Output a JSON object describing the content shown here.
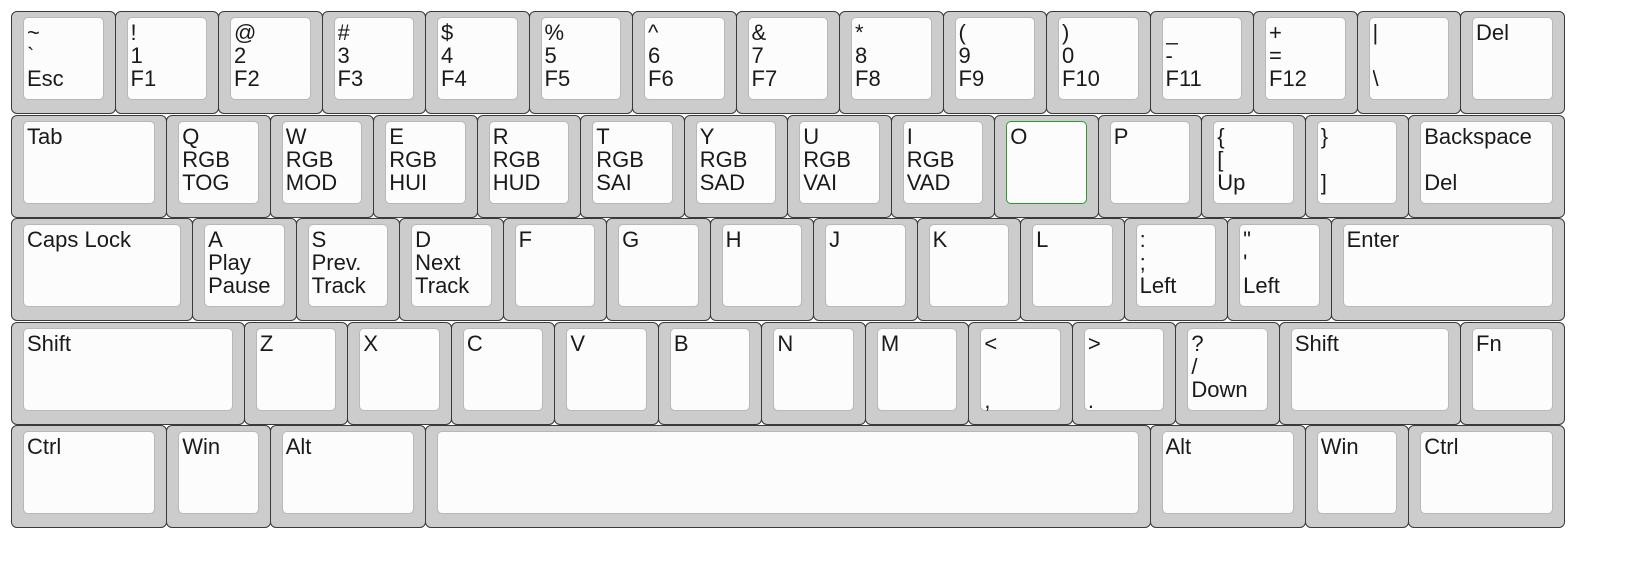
{
  "keyboard": {
    "rows": [
      {
        "keys": [
          {
            "id": "esc",
            "units": 1,
            "legends": [
              "~",
              "`",
              "Esc"
            ],
            "mode": "stack"
          },
          {
            "id": "1",
            "units": 1,
            "legends": [
              "!",
              "1",
              "F1"
            ],
            "mode": "stack"
          },
          {
            "id": "2",
            "units": 1,
            "legends": [
              "@",
              "2",
              "F2"
            ],
            "mode": "stack"
          },
          {
            "id": "3",
            "units": 1,
            "legends": [
              "#",
              "3",
              "F3"
            ],
            "mode": "stack"
          },
          {
            "id": "4",
            "units": 1,
            "legends": [
              "$",
              "4",
              "F4"
            ],
            "mode": "stack"
          },
          {
            "id": "5",
            "units": 1,
            "legends": [
              "%",
              "5",
              "F5"
            ],
            "mode": "stack"
          },
          {
            "id": "6",
            "units": 1,
            "legends": [
              "^",
              "6",
              "F6"
            ],
            "mode": "stack"
          },
          {
            "id": "7",
            "units": 1,
            "legends": [
              "&",
              "7",
              "F7"
            ],
            "mode": "stack"
          },
          {
            "id": "8",
            "units": 1,
            "legends": [
              "*",
              "8",
              "F8"
            ],
            "mode": "stack"
          },
          {
            "id": "9",
            "units": 1,
            "legends": [
              "(",
              "9",
              "F9"
            ],
            "mode": "stack"
          },
          {
            "id": "0",
            "units": 1,
            "legends": [
              ")",
              "0",
              "F10"
            ],
            "mode": "stack"
          },
          {
            "id": "minus",
            "units": 1,
            "legends": [
              "_",
              "-",
              "F11"
            ],
            "mode": "stack"
          },
          {
            "id": "equal",
            "units": 1,
            "legends": [
              "+",
              "=",
              "F12"
            ],
            "mode": "stack"
          },
          {
            "id": "backslash",
            "units": 1,
            "legends": [
              "|",
              "",
              "\\"
            ],
            "mode": "stack"
          },
          {
            "id": "del",
            "units": 1,
            "legends": [
              "Del"
            ],
            "mode": "stack"
          }
        ]
      },
      {
        "keys": [
          {
            "id": "tab",
            "units": 1.5,
            "legends": [
              "Tab"
            ],
            "mode": "stack"
          },
          {
            "id": "q",
            "units": 1,
            "legends": [
              "Q",
              "RGB",
              "TOG"
            ],
            "mode": "stack"
          },
          {
            "id": "w",
            "units": 1,
            "legends": [
              "W",
              "RGB",
              "MOD"
            ],
            "mode": "stack"
          },
          {
            "id": "e",
            "units": 1,
            "legends": [
              "E",
              "RGB",
              "HUI"
            ],
            "mode": "stack"
          },
          {
            "id": "r",
            "units": 1,
            "legends": [
              "R",
              "RGB",
              "HUD"
            ],
            "mode": "stack"
          },
          {
            "id": "t",
            "units": 1,
            "legends": [
              "T",
              "RGB",
              "SAI"
            ],
            "mode": "stack"
          },
          {
            "id": "y",
            "units": 1,
            "legends": [
              "Y",
              "RGB",
              "SAD"
            ],
            "mode": "stack"
          },
          {
            "id": "u",
            "units": 1,
            "legends": [
              "U",
              "RGB",
              "VAI"
            ],
            "mode": "stack"
          },
          {
            "id": "i",
            "units": 1,
            "legends": [
              "I",
              "RGB",
              "VAD"
            ],
            "mode": "stack"
          },
          {
            "id": "o",
            "units": 1,
            "legends": [
              "O"
            ],
            "mode": "stack",
            "selected": true
          },
          {
            "id": "p",
            "units": 1,
            "legends": [
              "P"
            ],
            "mode": "stack"
          },
          {
            "id": "lbracket",
            "units": 1,
            "legends": [
              "{",
              "[",
              "Up"
            ],
            "mode": "stack"
          },
          {
            "id": "rbracket",
            "units": 1,
            "legends": [
              "}",
              "",
              "]"
            ],
            "mode": "stack"
          },
          {
            "id": "backspace",
            "units": 1.5,
            "legends": [
              "Backspace",
              "",
              "Del"
            ],
            "mode": "stack"
          }
        ]
      },
      {
        "keys": [
          {
            "id": "caps",
            "units": 1.75,
            "legends": [
              "Caps Lock"
            ],
            "mode": "stack"
          },
          {
            "id": "a",
            "units": 1,
            "legends": [
              "A",
              "Play",
              "Pause"
            ],
            "mode": "stack"
          },
          {
            "id": "s",
            "units": 1,
            "legends": [
              "S",
              "Prev.",
              "Track"
            ],
            "mode": "stack"
          },
          {
            "id": "d",
            "units": 1,
            "legends": [
              "D",
              "Next",
              "Track"
            ],
            "mode": "stack"
          },
          {
            "id": "f",
            "units": 1,
            "legends": [
              "F"
            ],
            "mode": "stack"
          },
          {
            "id": "g",
            "units": 1,
            "legends": [
              "G"
            ],
            "mode": "stack"
          },
          {
            "id": "h",
            "units": 1,
            "legends": [
              "H"
            ],
            "mode": "stack"
          },
          {
            "id": "j",
            "units": 1,
            "legends": [
              "J"
            ],
            "mode": "stack"
          },
          {
            "id": "k",
            "units": 1,
            "legends": [
              "K"
            ],
            "mode": "stack"
          },
          {
            "id": "l",
            "units": 1,
            "legends": [
              "L"
            ],
            "mode": "stack"
          },
          {
            "id": "semicolon",
            "units": 1,
            "legends": [
              ":",
              ";",
              "Left"
            ],
            "mode": "stack"
          },
          {
            "id": "quote",
            "units": 1,
            "legends": [
              "\"",
              "'",
              "Left"
            ],
            "mode": "stack"
          },
          {
            "id": "enter",
            "units": 2.25,
            "legends": [
              "Enter"
            ],
            "mode": "stack"
          }
        ]
      },
      {
        "keys": [
          {
            "id": "lshift",
            "units": 2.25,
            "legends": [
              "Shift"
            ],
            "mode": "stack"
          },
          {
            "id": "z",
            "units": 1,
            "legends": [
              "Z"
            ],
            "mode": "stack"
          },
          {
            "id": "x",
            "units": 1,
            "legends": [
              "X"
            ],
            "mode": "stack"
          },
          {
            "id": "c",
            "units": 1,
            "legends": [
              "C"
            ],
            "mode": "stack"
          },
          {
            "id": "v",
            "units": 1,
            "legends": [
              "V"
            ],
            "mode": "stack"
          },
          {
            "id": "b",
            "units": 1,
            "legends": [
              "B"
            ],
            "mode": "stack"
          },
          {
            "id": "n",
            "units": 1,
            "legends": [
              "N"
            ],
            "mode": "stack"
          },
          {
            "id": "m",
            "units": 1,
            "legends": [
              "M"
            ],
            "mode": "stack"
          },
          {
            "id": "comma",
            "units": 1,
            "legends": [
              "<",
              ","
            ],
            "mode": "spread"
          },
          {
            "id": "period",
            "units": 1,
            "legends": [
              ">",
              "."
            ],
            "mode": "spread"
          },
          {
            "id": "slash",
            "units": 1,
            "legends": [
              "?",
              "/",
              "Down"
            ],
            "mode": "stack"
          },
          {
            "id": "rshift",
            "units": 1.75,
            "legends": [
              "Shift"
            ],
            "mode": "stack"
          },
          {
            "id": "fn",
            "units": 1,
            "legends": [
              "Fn"
            ],
            "mode": "stack"
          }
        ]
      },
      {
        "keys": [
          {
            "id": "lctrl",
            "units": 1.5,
            "legends": [
              "Ctrl"
            ],
            "mode": "stack"
          },
          {
            "id": "lwin",
            "units": 1,
            "legends": [
              "Win"
            ],
            "mode": "stack"
          },
          {
            "id": "lalt",
            "units": 1.5,
            "legends": [
              "Alt"
            ],
            "mode": "stack"
          },
          {
            "id": "space",
            "units": 7,
            "legends": [],
            "mode": "stack"
          },
          {
            "id": "ralt",
            "units": 1.5,
            "legends": [
              "Alt"
            ],
            "mode": "stack"
          },
          {
            "id": "rwin",
            "units": 1,
            "legends": [
              "Win"
            ],
            "mode": "stack"
          },
          {
            "id": "rctrl",
            "units": 1.5,
            "legends": [
              "Ctrl"
            ],
            "mode": "stack"
          }
        ]
      }
    ],
    "colors": {
      "key_base": "#cccccc",
      "key_cap": "#fcfcfc",
      "key_border": "#3a3a3a",
      "selected_outline": "#2e9a2e",
      "legend_text": "#1a1a1a"
    }
  }
}
